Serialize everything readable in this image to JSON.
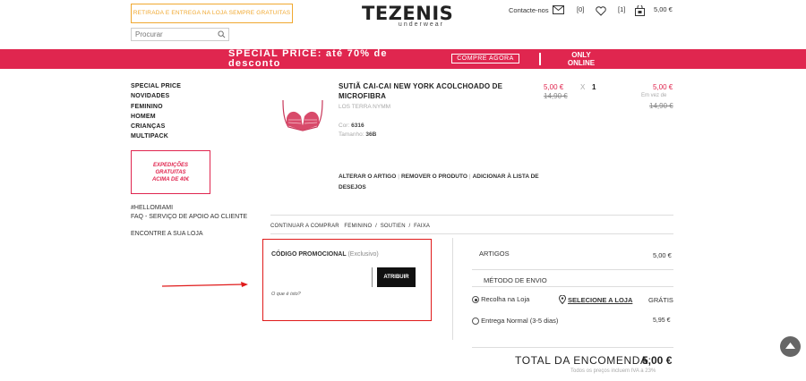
{
  "header": {
    "promo_text": "RETIRADA E ENTREGA NA LOJA SEMPRE GRATUITAS",
    "search_placeholder": "Procurar",
    "brand": "TEZENIS",
    "brand_sub": "underwear",
    "contact_label": "Contacte-nos",
    "mail_count": "[0]",
    "wishlist_count": "[1]",
    "cart_total": "5,00 €"
  },
  "banner": {
    "text": "SPECIAL PRICE: até 70% de desconto",
    "cta": "COMPRE AGORA",
    "only_online": "ONLY ONLINE",
    "color": "#e0264f"
  },
  "sidebar": {
    "nav": [
      "SPECIAL PRICE",
      "NOVIDADES",
      "FEMININO",
      "HOMEM",
      "CRIANÇAS",
      "MULTIPACK"
    ],
    "shipping_box": [
      "EXPEDIÇÕES",
      "GRATUITAS",
      "ACIMA DE 40€"
    ],
    "links": [
      "#HELLOMIAMI",
      "FAQ - SERVIÇO DE APOIO AO CLIENTE"
    ],
    "store_locator": "ENCONTRE A SUA LOJA"
  },
  "product": {
    "title": "SUTIÃ CAI-CAI NEW YORK ACOLCHOADO DE MICROFIBRA",
    "code": "LOS TERRA NYMM",
    "color_label": "Cor:",
    "color_value": "6316",
    "size_label": "Tamanho:",
    "size_value": "36B",
    "unit_price": "5,00 €",
    "unit_price_old": "14,90 €",
    "qty_sep": "X",
    "qty": "1",
    "line_price": "5,00 €",
    "line_price_note": "Em vez de",
    "line_price_old": "14,90 €",
    "actions": [
      "ALTERAR O ARTIGO",
      "REMOVER O PRODUTO",
      "ADICIONAR À LISTA DE DESEJOS"
    ]
  },
  "breadcrumb": {
    "continue": "CONTINUAR A COMPRAR",
    "path": [
      "FEMININO",
      "SOUTIEN",
      "FAIXA"
    ],
    "sep": "/"
  },
  "promo_code": {
    "label": "CÓDIGO PROMOCIONAL",
    "label_note": "(Exclusivo)",
    "button": "ATRIBUIR",
    "help": "O que é isto?"
  },
  "summary": {
    "items_label": "ARTIGOS",
    "items_value": "5,00 €",
    "shipping_method": "MÉTODO DE ENVIO",
    "options": [
      {
        "label": "Recolha na Loja",
        "selected": true,
        "link": "SELECIONE A LOJA",
        "price": "GRÁTIS"
      },
      {
        "label": "Entrega Normal (3-5 dias)",
        "selected": false,
        "price": "5,95 €"
      }
    ],
    "total_label": "TOTAL DA ENCOMENDA:",
    "total_value": "5,00 €",
    "iva_note": "Todos os preços incluem IVA a 23%"
  }
}
